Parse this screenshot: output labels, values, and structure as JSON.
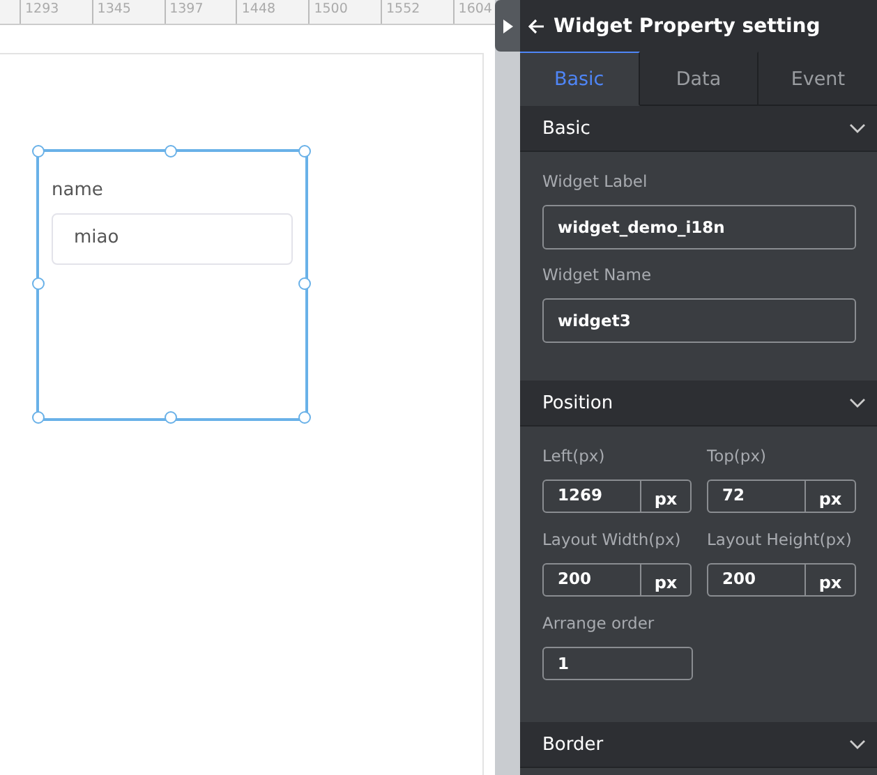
{
  "ruler": {
    "labels": [
      "1293",
      "1345",
      "1397",
      "1448",
      "1500",
      "1552",
      "1604"
    ]
  },
  "canvas": {
    "widget": {
      "label": "name",
      "value": "miao",
      "selected": true
    }
  },
  "panel": {
    "title": "Widget Property setting",
    "tabs": [
      {
        "label": "Basic",
        "selected": true
      },
      {
        "label": "Data",
        "selected": false
      },
      {
        "label": "Event",
        "selected": false
      }
    ],
    "sections": [
      {
        "title": "Basic",
        "rows": [
          [
            {
              "kind": "text",
              "label": "Widget Label",
              "value": "widget_demo_i18n"
            }
          ],
          [
            {
              "kind": "text",
              "label": "Widget Name",
              "value": "widget3"
            }
          ]
        ]
      },
      {
        "title": "Position",
        "rows": [
          [
            {
              "kind": "unit",
              "label": "Left(px)",
              "value": "1269",
              "unit": "px"
            },
            {
              "kind": "unit",
              "label": "Top(px)",
              "value": "72",
              "unit": "px"
            }
          ],
          [
            {
              "kind": "unit",
              "label": "Layout Width(px)",
              "value": "200",
              "unit": "px"
            },
            {
              "kind": "unit",
              "label": "Layout Height(px)",
              "value": "200",
              "unit": "px"
            }
          ],
          [
            {
              "kind": "short",
              "label": "Arrange order",
              "value": "1"
            }
          ]
        ]
      },
      {
        "title": "Border"
      }
    ]
  }
}
